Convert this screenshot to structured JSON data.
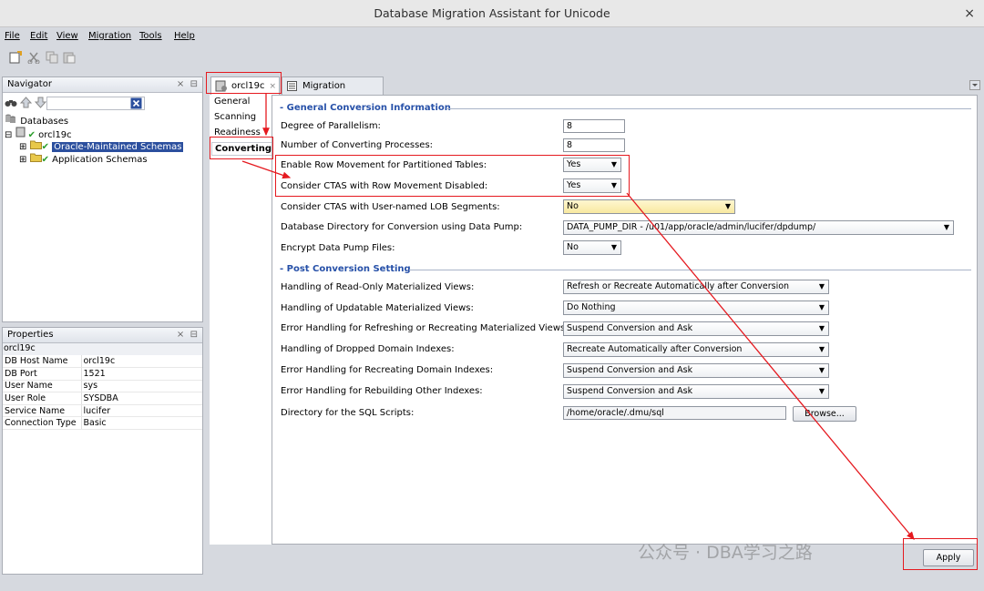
{
  "window": {
    "title": "Database Migration Assistant for Unicode",
    "close_glyph": "×"
  },
  "menu": [
    "File",
    "Edit",
    "View",
    "Migration",
    "Tools",
    "Help"
  ],
  "navigator": {
    "title": "Navigator",
    "root_label": "Databases",
    "db_label": "orcl19c",
    "items": [
      "Oracle-Maintained Schemas",
      "Application Schemas"
    ]
  },
  "properties": {
    "title": "Properties",
    "heading": "orcl19c",
    "rows": [
      [
        "DB Host Name",
        "orcl19c"
      ],
      [
        "DB Port",
        "1521"
      ],
      [
        "User Name",
        "sys"
      ],
      [
        "User Role",
        "SYSDBA"
      ],
      [
        "Service Name",
        "lucifer"
      ],
      [
        "Connection Type",
        "Basic"
      ]
    ]
  },
  "tabs": [
    {
      "label": "orcl19c",
      "active": true
    },
    {
      "label": "Migration Status",
      "active": false
    }
  ],
  "left_nav": [
    "General",
    "Scanning",
    "Readiness",
    "Converting"
  ],
  "general_section": {
    "title": "- General Conversion Information",
    "fields": [
      {
        "label": "Degree of Parallelism:",
        "value": "8",
        "kind": "input"
      },
      {
        "label": "Number of Converting Processes:",
        "value": "8",
        "kind": "input"
      },
      {
        "label": "Enable Row Movement for Partitioned Tables:",
        "value": "Yes",
        "kind": "select"
      },
      {
        "label": "Consider CTAS with Row Movement Disabled:",
        "value": "Yes",
        "kind": "select"
      },
      {
        "label": "Consider CTAS with User-named LOB Segments:",
        "value": "No",
        "kind": "select"
      },
      {
        "label": "Database Directory for Conversion using Data Pump:",
        "value": "DATA_PUMP_DIR - /u01/app/oracle/admin/lucifer/dpdump/",
        "kind": "select"
      },
      {
        "label": "Encrypt Data Pump Files:",
        "value": "No",
        "kind": "select"
      }
    ]
  },
  "post_section": {
    "title": "- Post Conversion Setting",
    "fields": [
      {
        "label": "Handling of Read-Only Materialized Views:",
        "value": "Refresh or Recreate Automatically after Conversion"
      },
      {
        "label": "Handling of Updatable Materialized Views:",
        "value": "Do Nothing"
      },
      {
        "label": "Error Handling for Refreshing or Recreating Materialized Views:",
        "value": "Suspend Conversion and Ask"
      },
      {
        "label": "Handling of Dropped Domain Indexes:",
        "value": "Recreate Automatically after Conversion"
      },
      {
        "label": "Error Handling for Recreating Domain Indexes:",
        "value": "Suspend Conversion and Ask"
      },
      {
        "label": "Error Handling for Rebuilding Other Indexes:",
        "value": "Suspend Conversion and Ask"
      }
    ],
    "sql_dir_label": "Directory for the SQL Scripts:",
    "sql_dir_value": "/home/oracle/.dmu/sql",
    "browse_label": "Browse..."
  },
  "apply_label": "Apply",
  "watermark": "公众号 · DBA学习之路",
  "colors": {
    "section": "#2650a8",
    "selection": "#2b4f9e",
    "annotation": "#e5191f"
  }
}
